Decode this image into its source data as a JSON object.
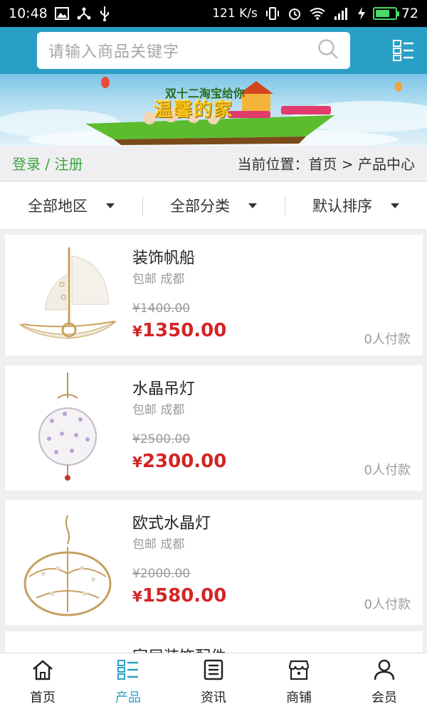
{
  "status_bar": {
    "time": "10:48",
    "net_speed": "121 K/s",
    "battery": "72",
    "battery_level": 0.72
  },
  "header": {
    "search_placeholder": "请输入商品关键字",
    "menu_icon": "list-menu-icon"
  },
  "banner": {
    "headline_small": "双十二淘宝给你",
    "headline_big": "温馨的家"
  },
  "breadcrumb": {
    "login_register": "登录 / 注册",
    "location": "当前位置：首页 > 产品中心"
  },
  "filters": [
    {
      "label": "全部地区"
    },
    {
      "label": "全部分类"
    },
    {
      "label": "默认排序"
    }
  ],
  "products": [
    {
      "name": "装饰帆船",
      "meta": "包邮 成都",
      "old_price": "¥1400.00",
      "currency": "¥",
      "price": "1350.00",
      "sold": "0人付款"
    },
    {
      "name": "水晶吊灯",
      "meta": "包邮 成都",
      "old_price": "¥2500.00",
      "currency": "¥",
      "price": "2300.00",
      "sold": "0人付款"
    },
    {
      "name": "欧式水晶灯",
      "meta": "包邮 成都",
      "old_price": "¥2000.00",
      "currency": "¥",
      "price": "1580.00",
      "sold": "0人付款"
    }
  ],
  "partial_product": {
    "name": "家居装饰配件"
  },
  "bottom_nav": [
    {
      "label": "首页",
      "icon": "home-icon"
    },
    {
      "label": "产品",
      "icon": "grid-list-icon"
    },
    {
      "label": "资讯",
      "icon": "news-icon"
    },
    {
      "label": "商铺",
      "icon": "store-icon"
    },
    {
      "label": "会员",
      "icon": "user-icon"
    }
  ],
  "colors": {
    "header": "#2a9fc6",
    "accent_green": "#3ca53c",
    "price_red": "#d42424",
    "nav_active": "#2a9fc6"
  }
}
